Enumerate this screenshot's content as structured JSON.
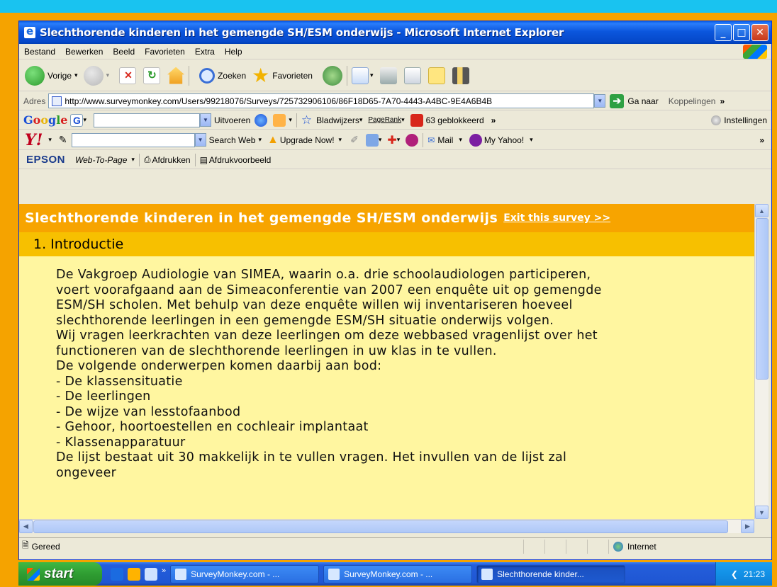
{
  "window": {
    "title": "Slechthorende kinderen in het gemengde SH/ESM onderwijs - Microsoft Internet Explorer",
    "min_glyph": "_",
    "max_glyph": "□",
    "close_glyph": "✕"
  },
  "menu": [
    "Bestand",
    "Bewerken",
    "Beeld",
    "Favorieten",
    "Extra",
    "Help"
  ],
  "toolbar": {
    "back": "Vorige",
    "search": "Zoeken",
    "favorites": "Favorieten"
  },
  "address": {
    "label": "Adres",
    "url": "http://www.surveymonkey.com/Users/99218076/Surveys/725732906106/86F18D65-7A70-4443-A4BC-9E4A6B4B",
    "go": "Ga naar",
    "links": "Koppelingen"
  },
  "google_bar": {
    "run": "Uitvoeren",
    "bookmarks": "Bladwijzers",
    "pagerank": "PageRank",
    "blocked": "63 geblokkeerd",
    "settings": "Instellingen"
  },
  "yahoo_bar": {
    "search_web": "Search Web",
    "upgrade": "Upgrade Now!",
    "mail": "Mail",
    "my_yahoo": "My Yahoo!"
  },
  "epson_bar": {
    "logo": "EPSON",
    "web_to_page": "Web-To-Page",
    "print": "Afdrukken",
    "preview": "Afdrukvoorbeeld"
  },
  "survey": {
    "title": "Slechthorende kinderen in het gemengde SH/ESM onderwijs",
    "exit": "Exit this survey >>",
    "section": "1. Introductie",
    "lines": [
      "De Vakgroep Audiologie van SIMEA, waarin o.a. drie schoolaudiologen participeren,",
      "voert voorafgaand aan de Simeaconferentie van 2007 een enquête uit op gemengde",
      "ESM/SH scholen. Met behulp van deze enquête willen wij inventariseren hoeveel",
      "slechthorende leerlingen in een gemengde ESM/SH situatie onderwijs volgen.",
      "Wij vragen leerkrachten van deze leerlingen om deze webbased vragenlijst over het",
      "functioneren van de slechthorende leerlingen in uw klas in te vullen.",
      "De volgende onderwerpen komen daarbij aan bod:",
      "- De klassensituatie",
      "- De leerlingen",
      "- De wijze van lesstofaanbod",
      "- Gehoor, hoortoestellen en cochleair implantaat",
      "- Klassenapparatuur",
      "De lijst bestaat uit 30 makkelijk in te vullen vragen. Het invullen van de lijst zal",
      "ongeveer"
    ]
  },
  "status": {
    "text": "Gereed",
    "zone": "Internet"
  },
  "taskbar": {
    "start": "start",
    "tasks": [
      "SurveyMonkey.com - ...",
      "SurveyMonkey.com - ...",
      "Slechthorende kinder..."
    ],
    "time": "21:23"
  }
}
